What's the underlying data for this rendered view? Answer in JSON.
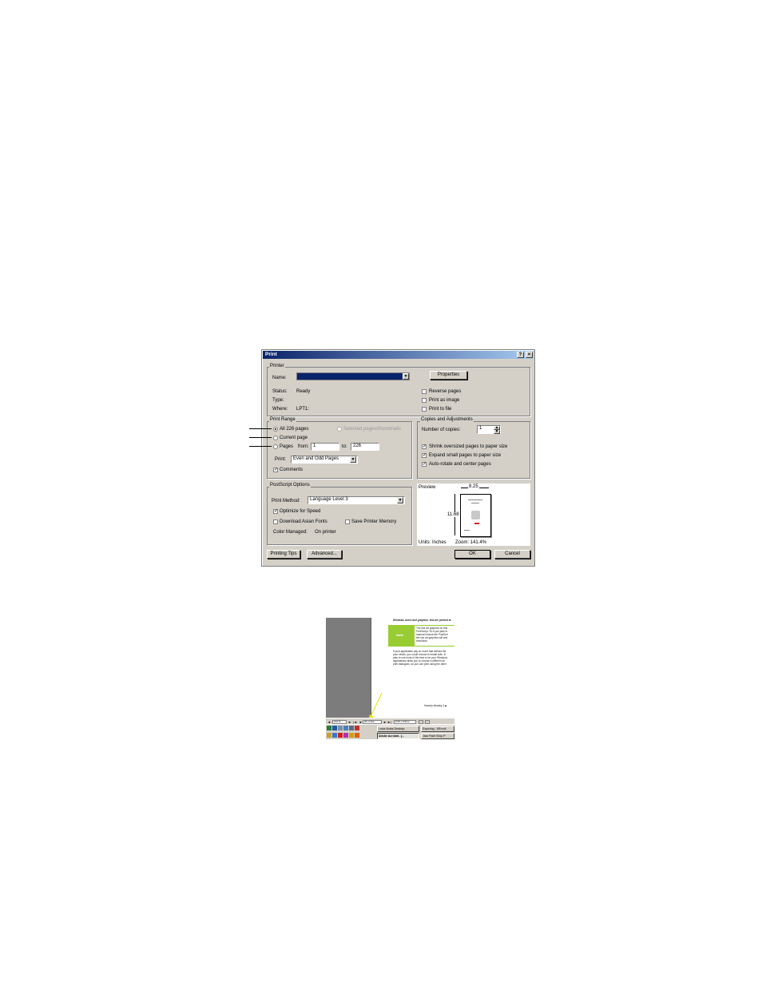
{
  "dialog": {
    "title": "Print",
    "help_glyph": "?",
    "close_glyph": "×",
    "printer_group": "Printer",
    "name_label": "Name:",
    "name_value": "",
    "properties_button": "Properties",
    "status_label": "Status:",
    "status_value": "Ready",
    "type_label": "Type:",
    "type_value": "",
    "where_label": "Where:",
    "where_value": "LPT1:",
    "reverse_pages": "Reverse pages",
    "print_as_image": "Print as image",
    "print_to_file": "Print to file",
    "print_range_group": "Print Range",
    "all_pages": "All 226 pages",
    "selected_pages": "Selected pages/thumbnails",
    "current_page": "Current page",
    "pages_label": "Pages",
    "from_label": "from:",
    "from_value": "1",
    "to_label": "to:",
    "to_value": "226",
    "print_label": "Print:",
    "print_select": "Even and Odd Pages",
    "comments": "Comments",
    "copies_group": "Copies and Adjustments",
    "copies_label": "Number of copies:",
    "copies_value": "1",
    "shrink": "Shrink oversized pages to paper size",
    "expand": "Expand small pages to paper size",
    "autorotate": "Auto-rotate and center pages",
    "postscript_group": "PostScript Options",
    "print_method_label": "Print Method:",
    "print_method_value": "Language Level 3",
    "optimize": "Optimize for Speed",
    "download_fonts": "Download Asian Fonts",
    "save_memory": "Save Printer Memory",
    "color_managed_label": "Color Managed:",
    "color_managed_value": "On printer",
    "preview_label": "Preview",
    "preview_width": "8.25",
    "preview_height": "11.68",
    "units": "Units: Inches",
    "zoom": "Zoom: 141.4%",
    "printing_tips_button": "Printing Tips",
    "advanced_button": "Advanced...",
    "ok_button": "OK",
    "cancel_button": "Cancel"
  },
  "acrobat": {
    "heading": "Windows users and graphics. this are printed at",
    "note_label": "Note",
    "note_lines": [
      "The line art graphics on this",
      "FreeScript. So if you plan to",
      "manual choose the PostScri",
      "the low art graphics will and",
      "resolution."
    ],
    "body_lines": [
      "If your application pay so much that without the",
      "your needs, you could choose to install both. D",
      "plan to use most of the time to be your Windows",
      "applications allow you to choose a different se",
      "print dialogues, so you can print using the other"
    ],
    "footer_text": "Hasedy ideasky 4 ◆",
    "zoom_value": "104 %",
    "page_value": "35 of 164",
    "size_value": "8.25 x 8.50 in",
    "task1": "Lotus Notes Desktop",
    "task2": "Exploring - 5/8 mot",
    "task3": "Adobe Acrobat - [...",
    "task4": "Jasc Paint Shop P"
  },
  "colors": {
    "title_start": "#0a246a",
    "title_end": "#a6caf0",
    "face": "#d4d0c8",
    "note_green": "#99cc33",
    "arrow_yellow": "#e8e000"
  }
}
